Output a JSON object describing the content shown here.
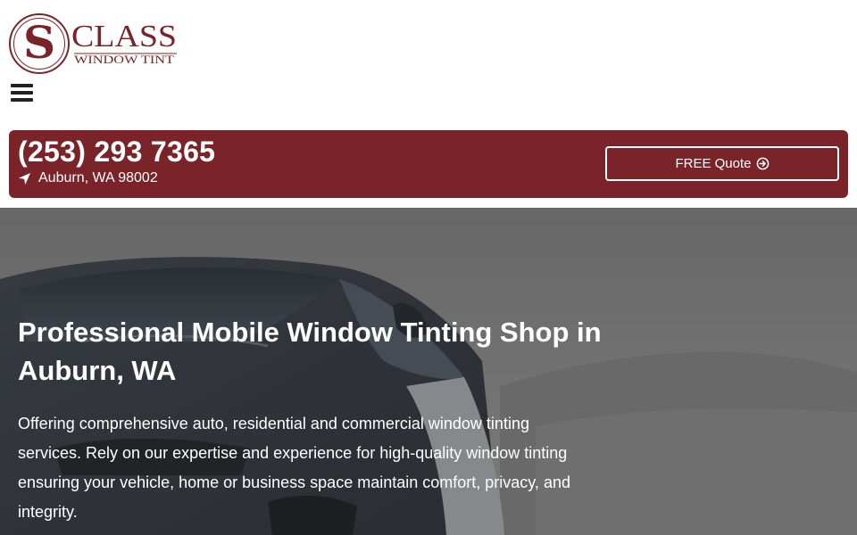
{
  "logo": {
    "letter": "S",
    "name": "CLASS",
    "tagline": "WINDOW TINT"
  },
  "nav": {
    "menu_icon": "hamburger-menu-icon"
  },
  "contact": {
    "phone": "(253) 293 7365",
    "address": "Auburn, WA 98002",
    "address_icon": "location-arrow-icon",
    "quote_label": "FREE Quote",
    "quote_icon": "arrow-circle-right-icon"
  },
  "hero": {
    "title": "Professional Mobile Window Tinting Shop in Auburn, WA",
    "description": "Offering comprehensive auto, residential and commercial window tinting services. Rely on our expertise and experience for high-quality window tinting ensuring your vehicle, home or business space maintain comfort, privacy, and integrity."
  },
  "colors": {
    "brand": "#7a2429",
    "white": "#ffffff",
    "text_dark": "#222222"
  }
}
